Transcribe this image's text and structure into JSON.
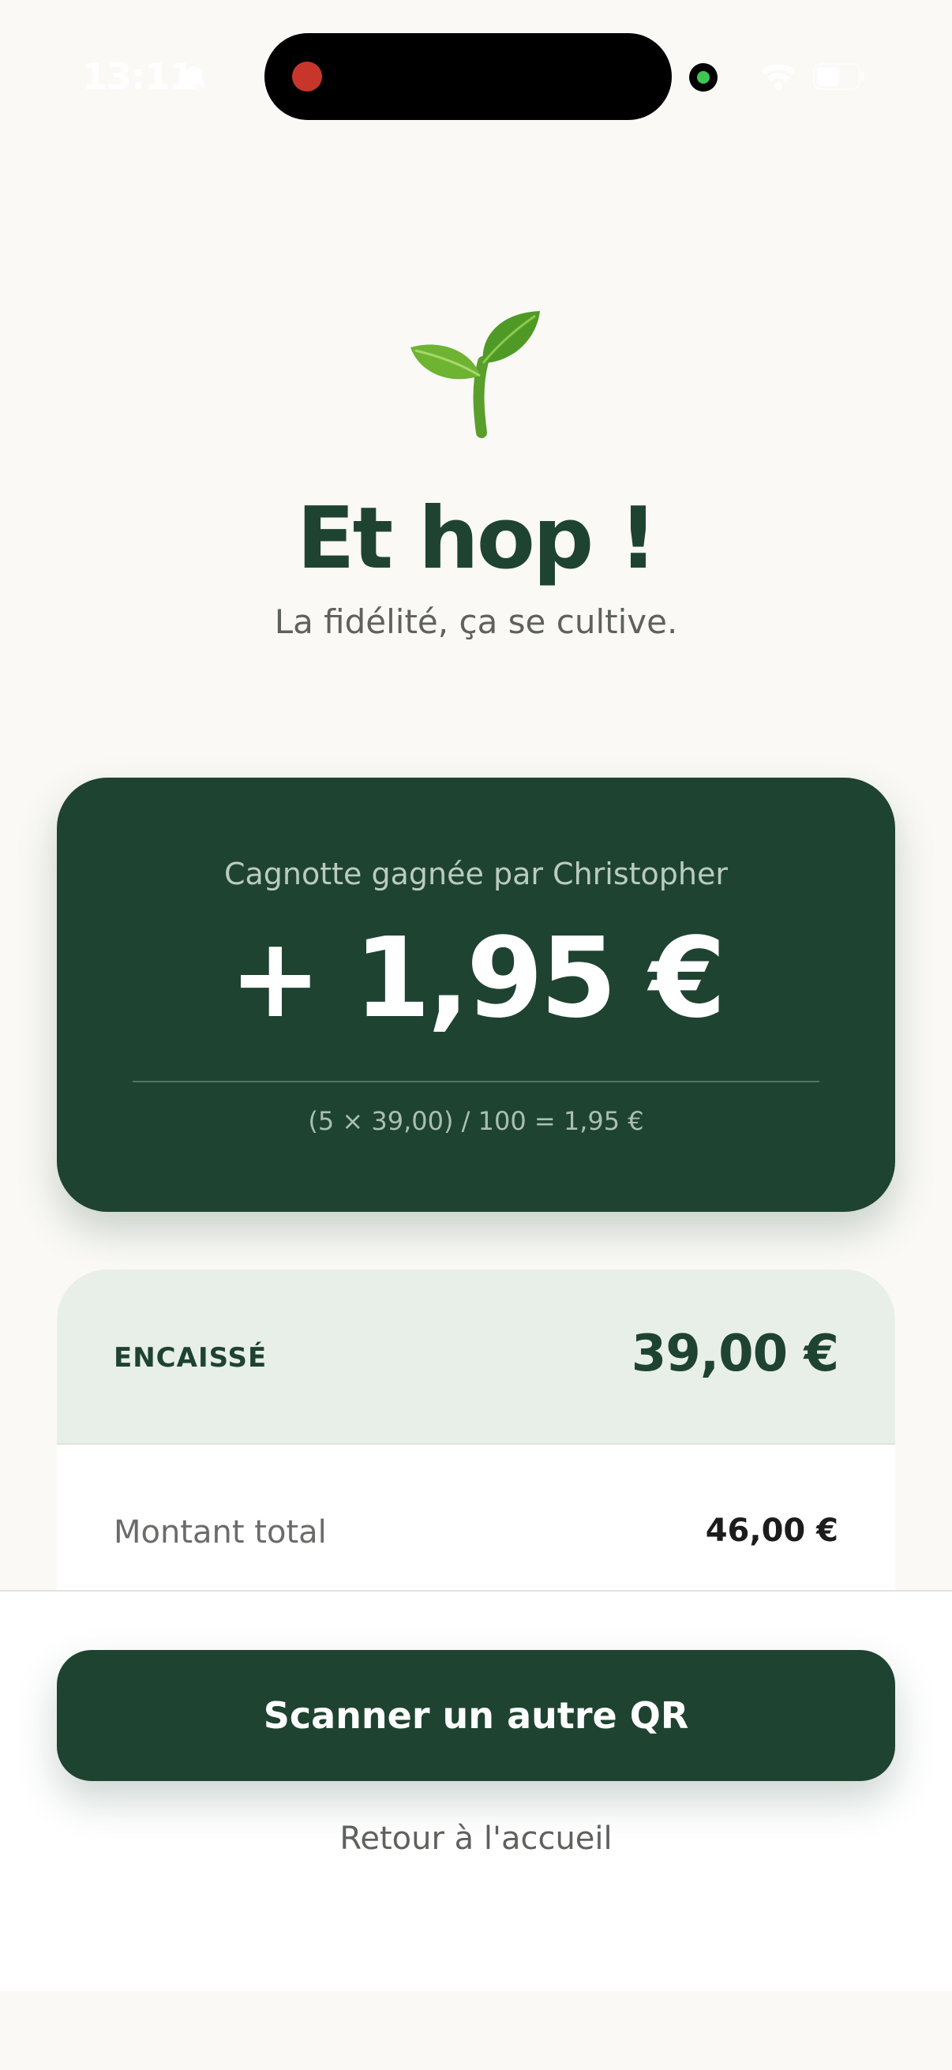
{
  "status_bar": {
    "time": "13:11",
    "icons": [
      "bell-slash-icon",
      "wifi-icon",
      "battery-icon"
    ]
  },
  "hero": {
    "icon": "sprout-icon",
    "title": "Et hop !",
    "subtitle": "La fidélité, ça se cultive."
  },
  "reward": {
    "label": "Cagnotte gagnée par Christopher",
    "amount": "+ 1,95 €",
    "formula": "(5 × 39,00) / 100 = 1,95 €"
  },
  "summary": {
    "encaisse_label": "ENCAISSÉ",
    "encaisse_value": "39,00 €",
    "total_label": "Montant total",
    "total_value": "46,00 €"
  },
  "actions": {
    "scan_label": "Scanner un autre QR",
    "home_label": "Retour à l'accueil"
  },
  "colors": {
    "brand_green": "#1f4331",
    "background": "#faf9f6",
    "summary_header": "#e8efe8"
  }
}
